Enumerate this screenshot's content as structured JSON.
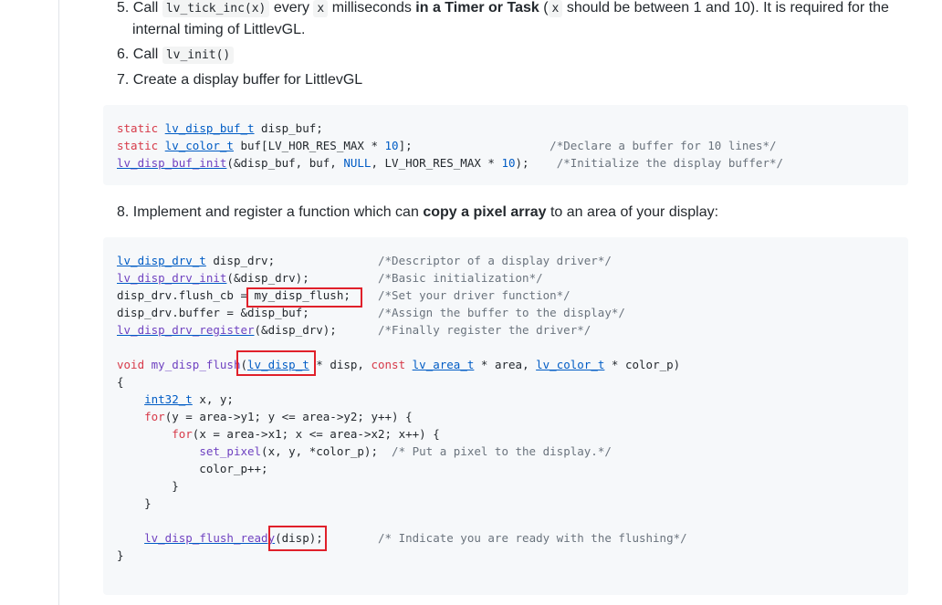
{
  "steps": {
    "s5": {
      "num": "5.",
      "call": "Call",
      "code1": "lv_tick_inc(x)",
      "every": "every",
      "code2": "x",
      "ms": "milliseconds",
      "bold": "in a Timer or Task",
      "paren_open": "(",
      "code3": "x",
      "rest": "should be between 1 and 10). It is required for the",
      "line2": "internal timing of LittlevGL."
    },
    "s6": {
      "num": "6.",
      "call": "Call",
      "code": "lv_init()"
    },
    "s7": {
      "num": "7.",
      "text": "Create a display buffer for LittlevGL"
    },
    "s8": {
      "num": "8.",
      "pre": "Implement and register a function which can",
      "bold": "copy a pixel array",
      "post": "to an area of your display:"
    }
  },
  "code_buffer": {
    "l1": "static lv_disp_buf_t disp_buf;",
    "l2a": "static lv_color_t buf[LV_HOR_RES_MAX * 10];",
    "l2c": "/*Declare a buffer for 10 lines*/",
    "l3a": "lv_disp_buf_init(&disp_buf, buf, NULL, LV_HOR_RES_MAX * 10);",
    "l3c": "/*Initialize the display buffer*/"
  },
  "code_driver": {
    "l1": "lv_disp_drv_t disp_drv;",
    "l1c": "/*Descriptor of a display driver*/",
    "l2": "lv_disp_drv_init(&disp_drv);",
    "l2c": "/*Basic initialization*/",
    "l3": "disp_drv.flush_cb = my_disp_flush;",
    "l3c": "/*Set your driver function*/",
    "l4": "disp_drv.buffer = &disp_buf;",
    "l4c": "/*Assign the buffer to the display*/",
    "l5": "lv_disp_drv_register(&disp_drv);",
    "l5c": "/*Finally register the driver*/",
    "f1": "void my_disp_flush(lv_disp_t * disp, const lv_area_t * area, lv_color_t * color_p)",
    "f2": "{",
    "f3": "    int32_t x, y;",
    "f4": "    for(y = area->y1; y <= area->y2; y++) {",
    "f5": "        for(x = area->x1; x <= area->x2; x++) {",
    "f6": "            set_pixel(x, y, *color_p);  /* Put a pixel to the display.*/",
    "f7": "            color_p++;",
    "f8": "        }",
    "f9": "    }",
    "f10": "    lv_disp_flush_ready(disp);",
    "f10c": "/* Indicate you are ready with the flushing*/",
    "f11": "}"
  },
  "colors": {
    "highlight_border": "#e0202a",
    "code_bg": "#f6f8fa",
    "keyword": "#d73a49",
    "function": "#6f42c1",
    "type": "#005cc5",
    "comment": "#6a737d"
  }
}
